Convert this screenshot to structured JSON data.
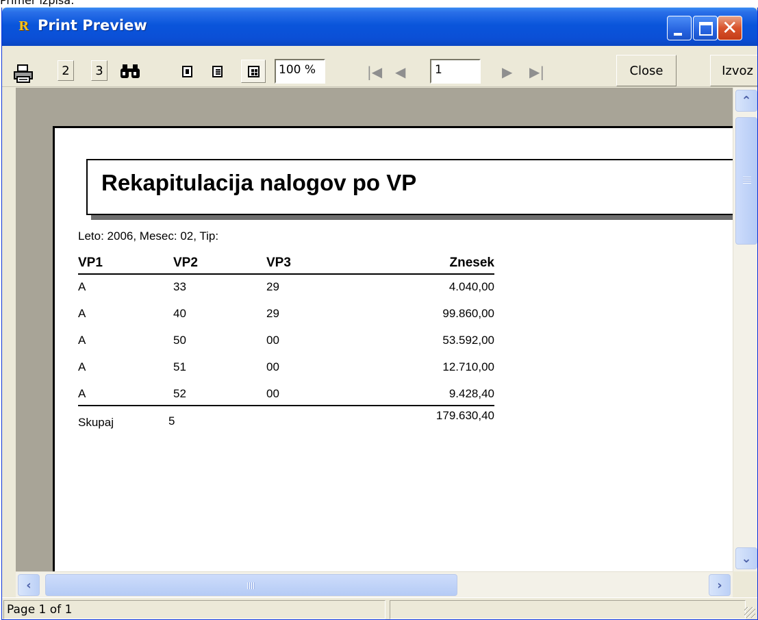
{
  "caption": "Primer izpisa:",
  "window": {
    "title": "Print Preview",
    "app_icon": "R"
  },
  "toolbar": {
    "btn_2": "2",
    "btn_3": "3",
    "zoom_value": "100 %",
    "page_value": "1",
    "close_label": "Close",
    "export_label": "Izvoz"
  },
  "report": {
    "title": "Rekapitulacija nalogov po VP",
    "params": "Leto: 2006,  Mesec: 02,  Tip:",
    "columns": [
      "VP1",
      "VP2",
      "VP3",
      "Znesek"
    ],
    "rows": [
      [
        "A",
        "33",
        "29",
        "4.040,00"
      ],
      [
        "A",
        "40",
        "29",
        "99.860,00"
      ],
      [
        "A",
        "50",
        "00",
        "53.592,00"
      ],
      [
        "A",
        "51",
        "00",
        "12.710,00"
      ],
      [
        "A",
        "52",
        "00",
        "9.428,40"
      ]
    ],
    "total_label": "Skupaj",
    "total_count": "5",
    "total_sum": "179.630,40"
  },
  "status": {
    "page_info": "Page 1 of 1"
  },
  "icons": {
    "print": "printer-icon",
    "find": "binoculars-icon",
    "view_single": "page-single-icon",
    "view_two": "page-two-icon",
    "view_multi": "page-multi-icon",
    "first": "first-page-icon",
    "prev": "prev-page-icon",
    "next": "next-page-icon",
    "last": "last-page-icon"
  },
  "colors": {
    "titlebar": "#0A55DB",
    "workspace": "#A8A497",
    "chrome": "#ECE9D8"
  }
}
